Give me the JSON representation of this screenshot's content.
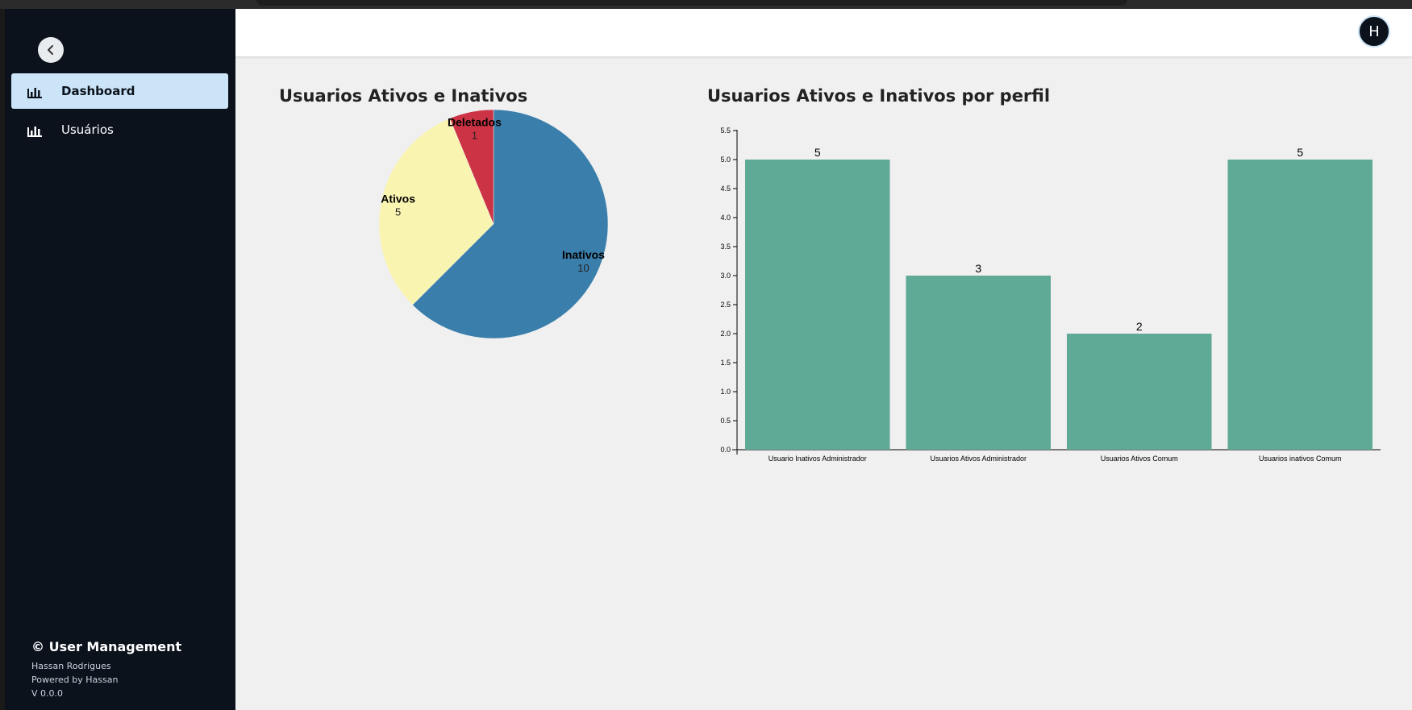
{
  "sidebar": {
    "collapse_icon": "chevron-left-icon",
    "items": [
      {
        "label": "Dashboard",
        "icon": "bar-chart-icon",
        "active": true
      },
      {
        "label": "Usuários",
        "icon": "bar-chart-icon",
        "active": false
      }
    ],
    "footer": {
      "brand": "© User Management",
      "author": "Hassan Rodrigues",
      "powered": "Powered by Hassan",
      "version": "V 0.0.0"
    }
  },
  "header": {
    "avatar_initial": "H"
  },
  "colors": {
    "sidebar_bg": "#0b121c",
    "active_item_bg": "#cce4f7",
    "bar_color": "#5faa96",
    "pie_inativos": "#3a7eab",
    "pie_ativos": "#faf4b1",
    "pie_deletados": "#cc3344"
  },
  "chart_data": [
    {
      "type": "pie",
      "title": "Usuarios Ativos e Inativos",
      "slices": [
        {
          "label": "Inativos",
          "value": 10,
          "color": "#3a7eab"
        },
        {
          "label": "Ativos",
          "value": 5,
          "color": "#faf4b1"
        },
        {
          "label": "Deletados",
          "value": 1,
          "color": "#cc3344"
        }
      ]
    },
    {
      "type": "bar",
      "title": "Usuarios Ativos e Inativos por perfil",
      "categories": [
        "Usuario Inativos Administrador",
        "Usuarios Ativos Administrador",
        "Usuarios Ativos Comum",
        "Usuarios inativos Comum"
      ],
      "values": [
        5,
        3,
        2,
        5
      ],
      "ylim": [
        0,
        5.5
      ],
      "yticks": [
        "0.0",
        "0.5",
        "1.0",
        "1.5",
        "2.0",
        "2.5",
        "3.0",
        "3.5",
        "4.0",
        "4.5",
        "5.0",
        "5.5"
      ],
      "grid": false,
      "color": "#5faa96"
    }
  ]
}
